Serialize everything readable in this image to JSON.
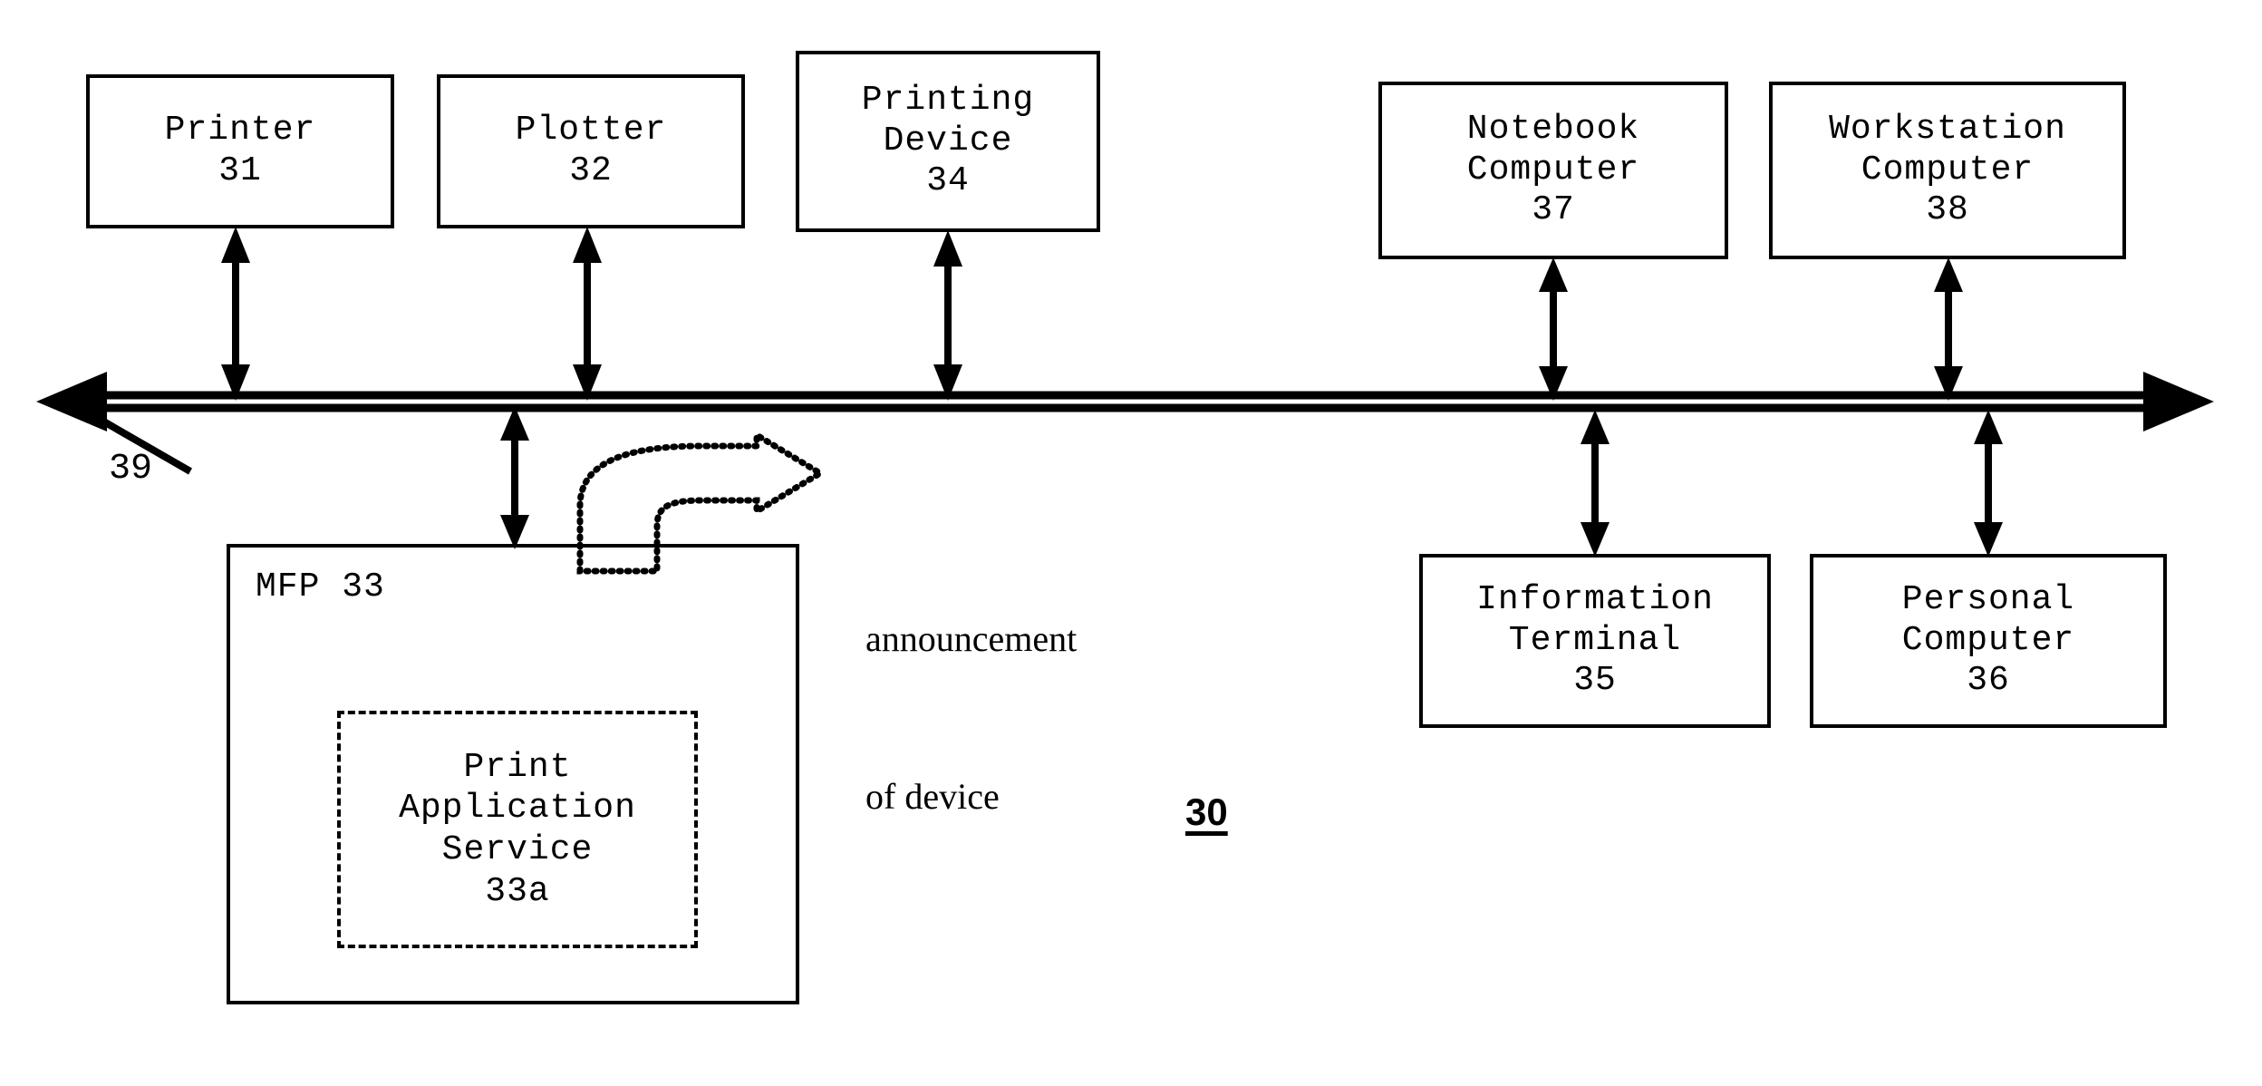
{
  "figure": {
    "number_label": "30",
    "bus_label": "39",
    "annotation": {
      "line1": "announcement",
      "line2": "of device"
    }
  },
  "devices": {
    "printer": {
      "line1": "Printer",
      "line2": "31"
    },
    "plotter": {
      "line1": "Plotter",
      "line2": "32"
    },
    "printing_device": {
      "line1": "Printing",
      "line2": "Device",
      "line3": "34"
    },
    "notebook_computer": {
      "line1": "Notebook",
      "line2": "Computer",
      "line3": "37"
    },
    "workstation_computer": {
      "line1": "Workstation",
      "line2": "Computer",
      "line3": "38"
    },
    "information_terminal": {
      "line1": "Information",
      "line2": "Terminal",
      "line3": "35"
    },
    "personal_computer": {
      "line1": "Personal",
      "line2": "Computer",
      "line3": "36"
    },
    "mfp": {
      "label": "MFP 33"
    },
    "print_application_service": {
      "line1": "Print",
      "line2": "Application",
      "line3": "Service",
      "line4": "33a"
    }
  },
  "colors": {
    "stroke": "#000000",
    "background": "#ffffff"
  }
}
